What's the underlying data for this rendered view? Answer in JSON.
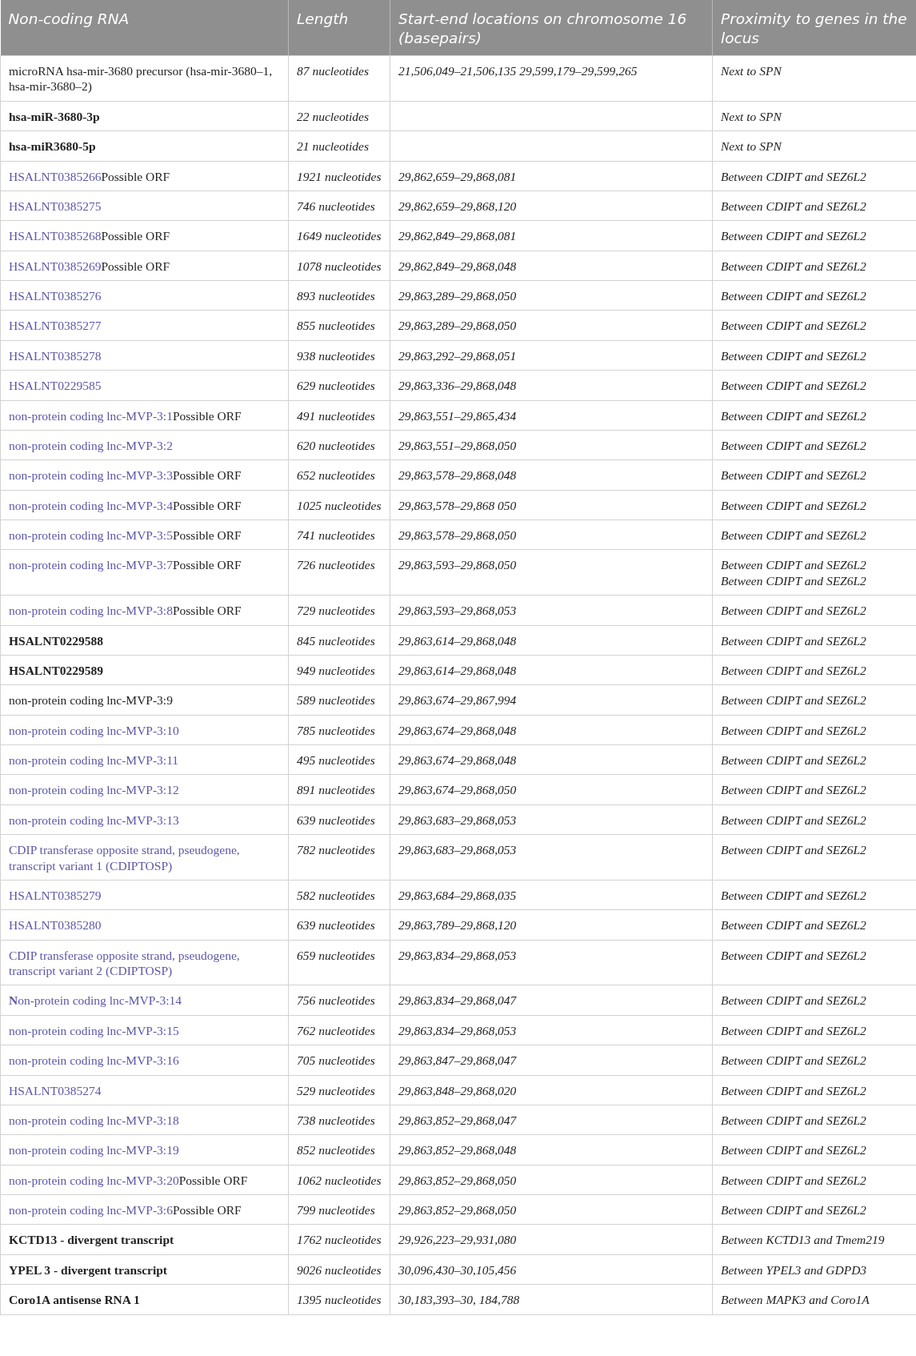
{
  "table": {
    "columns": [
      "Non-coding RNA",
      "Length",
      "Start-end locations on chromosome 16 (basepairs)",
      "Proximity to genes in the locus"
    ],
    "rows": [
      {
        "name": [
          {
            "kind": "plain",
            "text": "microRNA hsa-mir-3680 precursor (hsa-mir-3680–1, hsa-mir-3680–2)"
          }
        ],
        "length": "87 nucleotides",
        "location": "21,506,049–21,506,135 29,599,179–29,599,265",
        "proximity": "Next to SPN"
      },
      {
        "name": [
          {
            "kind": "bold",
            "text": "hsa-miR-3680-3p"
          }
        ],
        "length": "22 nucleotides",
        "proximity": "Next to SPN"
      },
      {
        "name": [
          {
            "kind": "bold",
            "text": "hsa-miR3680-5p"
          }
        ],
        "length": "21 nucleotides",
        "proximity": "Next to SPN"
      },
      {
        "name": [
          {
            "kind": "link",
            "text": "HSALNT0385266"
          },
          {
            "kind": "plain",
            "text": "Possible ORF"
          }
        ],
        "length": "1921 nucleotides",
        "location": "29,862,659–29,868,081",
        "proximity": "Between CDIPT and SEZ6L2"
      },
      {
        "name": [
          {
            "kind": "link",
            "text": "HSALNT0385275"
          }
        ],
        "length": "746 nucleotides",
        "location": "29,862,659–29,868,120",
        "proximity": "Between CDIPT and SEZ6L2"
      },
      {
        "name": [
          {
            "kind": "link",
            "text": "HSALNT0385268"
          },
          {
            "kind": "plain",
            "text": "Possible ORF"
          }
        ],
        "length": "1649 nucleotides",
        "location": "29,862,849–29,868,081",
        "proximity": "Between CDIPT and SEZ6L2"
      },
      {
        "name": [
          {
            "kind": "link",
            "text": "HSALNT0385269"
          },
          {
            "kind": "plain",
            "text": "Possible ORF"
          }
        ],
        "length": "1078 nucleotides",
        "location": "29,862,849–29,868,048",
        "proximity": "Between CDIPT and SEZ6L2"
      },
      {
        "name": [
          {
            "kind": "link",
            "text": "HSALNT0385276"
          }
        ],
        "length": "893 nucleotides",
        "location": "29,863,289–29,868,050",
        "proximity": "Between CDIPT and SEZ6L2"
      },
      {
        "name": [
          {
            "kind": "link",
            "text": "HSALNT0385277"
          }
        ],
        "length": "855 nucleotides",
        "location": "29,863,289–29,868,050",
        "proximity": "Between CDIPT and SEZ6L2"
      },
      {
        "name": [
          {
            "kind": "link",
            "text": "HSALNT0385278"
          }
        ],
        "length": "938 nucleotides",
        "location": "29,863,292–29,868,051",
        "proximity": "Between CDIPT and SEZ6L2"
      },
      {
        "name": [
          {
            "kind": "link",
            "text": "HSALNT0229585"
          }
        ],
        "length": "629 nucleotides",
        "location": "29,863,336–29,868,048",
        "proximity": "Between CDIPT and SEZ6L2"
      },
      {
        "name": [
          {
            "kind": "link",
            "text": "non-protein coding lnc-MVP-3:1"
          },
          {
            "kind": "plain",
            "text": "Possible ORF"
          }
        ],
        "length": "491 nucleotides",
        "location": "29,863,551–29,865,434",
        "proximity": "Between CDIPT and SEZ6L2"
      },
      {
        "name": [
          {
            "kind": "link",
            "text": "non-protein coding lnc-MVP-3:2"
          }
        ],
        "length": "620 nucleotides",
        "location": "29,863,551–29,868,050",
        "proximity": "Between CDIPT and SEZ6L2"
      },
      {
        "name": [
          {
            "kind": "link",
            "text": "non-protein coding lnc-MVP-3:3"
          },
          {
            "kind": "plain",
            "text": "Possible ORF"
          }
        ],
        "length": "652 nucleotides",
        "location": "29,863,578–29,868,048",
        "proximity": "Between CDIPT and SEZ6L2"
      },
      {
        "name": [
          {
            "kind": "link",
            "text": "non-protein coding lnc-MVP-3:4"
          },
          {
            "kind": "plain",
            "text": "Possible ORF"
          }
        ],
        "length": "1025 nucleotides",
        "location": "29,863,578–29,868 050",
        "proximity": "Between CDIPT and SEZ6L2"
      },
      {
        "name": [
          {
            "kind": "link",
            "text": "non-protein coding lnc-MVP-3:5"
          },
          {
            "kind": "plain",
            "text": "Possible ORF"
          }
        ],
        "length": "741 nucleotides",
        "location": "29,863,578–29,868,050",
        "proximity": "Between CDIPT and SEZ6L2"
      },
      {
        "name": [
          {
            "kind": "link",
            "text": "non-protein coding lnc-MVP-3:7"
          },
          {
            "kind": "plain",
            "text": "Possible ORF"
          }
        ],
        "length": "726 nucleotides",
        "location": "29,863,593–29,868,050",
        "proximity": "Between CDIPT and SEZ6L2 Between CDIPT and SEZ6L2"
      },
      {
        "name": [
          {
            "kind": "link",
            "text": "non-protein coding lnc-MVP-3:8"
          },
          {
            "kind": "plain",
            "text": "Possible ORF"
          }
        ],
        "length": "729 nucleotides",
        "location": "29,863,593–29,868,053",
        "proximity": "Between CDIPT and SEZ6L2"
      },
      {
        "name": [
          {
            "kind": "bold",
            "text": "HSALNT0229588"
          }
        ],
        "length": "845 nucleotides",
        "location": "29,863,614–29,868,048",
        "proximity": "Between CDIPT and SEZ6L2"
      },
      {
        "name": [
          {
            "kind": "bold",
            "text": "HSALNT0229589"
          }
        ],
        "length": "949 nucleotides",
        "location": "29,863,614–29,868,048",
        "proximity": "Between CDIPT and SEZ6L2"
      },
      {
        "name": [
          {
            "kind": "plain",
            "text": "non-protein coding lnc-MVP-3:9"
          }
        ],
        "length": "589 nucleotides",
        "location": "29,863,674–29,867,994",
        "proximity": "Between CDIPT and SEZ6L2"
      },
      {
        "name": [
          {
            "kind": "link",
            "text": "non-protein coding lnc-MVP-3:10"
          }
        ],
        "length": "785 nucleotides",
        "location": "29,863,674–29,868,048",
        "proximity": "Between CDIPT and SEZ6L2"
      },
      {
        "name": [
          {
            "kind": "link",
            "text": "non-protein coding lnc-MVP-3:11"
          }
        ],
        "length": "495 nucleotides",
        "location": "29,863,674–29,868,048",
        "proximity": "Between CDIPT and SEZ6L2"
      },
      {
        "name": [
          {
            "kind": "link",
            "text": "non-protein coding lnc-MVP-3:12"
          }
        ],
        "length": "891 nucleotides",
        "location": "29,863,674–29,868,050",
        "proximity": "Between CDIPT and SEZ6L2"
      },
      {
        "name": [
          {
            "kind": "link",
            "text": "non-protein coding lnc-MVP-3:13"
          }
        ],
        "length": "639 nucleotides",
        "location": "29,863,683–29,868,053",
        "proximity": "Between CDIPT and SEZ6L2"
      },
      {
        "name": [
          {
            "kind": "link",
            "text": "CDIP transferase opposite strand, pseudogene, transcript variant 1 (CDIPTOSP)"
          }
        ],
        "length": "782 nucleotides",
        "location": "29,863,683–29,868,053",
        "proximity": "Between CDIPT and SEZ6L2"
      },
      {
        "name": [
          {
            "kind": "link",
            "text": "HSALNT0385279"
          }
        ],
        "length": "582 nucleotides",
        "location": "29,863,684–29,868,035",
        "proximity": "Between CDIPT and SEZ6L2"
      },
      {
        "name": [
          {
            "kind": "link",
            "text": "HSALNT0385280"
          }
        ],
        "length": "639 nucleotides",
        "location": "29,863,789–29,868,120",
        "proximity": "Between CDIPT and SEZ6L2"
      },
      {
        "name": [
          {
            "kind": "link",
            "text": "CDIP transferase opposite strand, pseudogene, transcript variant 2 (CDIPTOSP)"
          }
        ],
        "length": "659 nucleotides",
        "location": "29,863,834–29,868,053",
        "proximity": "Between CDIPT and SEZ6L2"
      },
      {
        "name": [
          {
            "kind": "link",
            "text": "**N**on-protein coding lnc-MVP-3:14"
          }
        ],
        "length": "756 nucleotides",
        "location": "29,863,834–29,868,047",
        "proximity": "Between CDIPT and SEZ6L2"
      },
      {
        "name": [
          {
            "kind": "link",
            "text": "non-protein coding lnc-MVP-3:15"
          }
        ],
        "length": "762 nucleotides",
        "location": "29,863,834–29,868,053",
        "proximity": "Between CDIPT and SEZ6L2"
      },
      {
        "name": [
          {
            "kind": "link",
            "text": "non-protein coding lnc-MVP-3:16"
          }
        ],
        "length": "705 nucleotides",
        "location": "29,863,847–29,868,047",
        "proximity": "Between CDIPT and SEZ6L2"
      },
      {
        "name": [
          {
            "kind": "link",
            "text": "HSALNT0385274"
          }
        ],
        "length": "529 nucleotides",
        "location": "29,863,848–29,868,020",
        "proximity": "Between CDIPT and SEZ6L2"
      },
      {
        "name": [
          {
            "kind": "link",
            "text": "non-protein coding lnc-MVP-3:18"
          }
        ],
        "length": "738 nucleotides",
        "location": "29,863,852–29,868,047",
        "proximity": "Between CDIPT and SEZ6L2"
      },
      {
        "name": [
          {
            "kind": "link",
            "text": "non-protein coding lnc-MVP-3:19"
          }
        ],
        "length": "852 nucleotides",
        "location": "29,863,852–29,868,048",
        "proximity": "Between CDIPT and SEZ6L2"
      },
      {
        "name": [
          {
            "kind": "link",
            "text": "non-protein coding lnc-MVP-3:20"
          },
          {
            "kind": "plain",
            "text": "Possible ORF"
          }
        ],
        "length": "1062 nucleotides",
        "location": "29,863,852–29,868,050",
        "proximity": "Between CDIPT and SEZ6L2"
      },
      {
        "name": [
          {
            "kind": "link",
            "text": "non-protein coding lnc-MVP-3:6"
          },
          {
            "kind": "plain",
            "text": "Possible ORF"
          }
        ],
        "length": "799 nucleotides",
        "location": "29,863,852–29,868,050",
        "proximity": "Between CDIPT and SEZ6L2"
      },
      {
        "name": [
          {
            "kind": "bold",
            "text": "KCTD13 - divergent transcript"
          }
        ],
        "length": "1762 nucleotides",
        "location": "29,926,223–29,931,080",
        "proximity": "Between KCTD13 and Tmem219"
      },
      {
        "name": [
          {
            "kind": "bold",
            "text": "YPEL 3 - divergent transcript"
          }
        ],
        "length": "9026 nucleotides",
        "location": "30,096,430–30,105,456",
        "proximity": "Between YPEL3 and GDPD3"
      },
      {
        "name": [
          {
            "kind": "bold",
            "text": "Coro1A antisense RNA 1"
          }
        ],
        "length": "1395 nucleotides",
        "location": "30,183,393–30, 184,788",
        "proximity": "Between MAPK3 and Coro1A"
      }
    ]
  }
}
